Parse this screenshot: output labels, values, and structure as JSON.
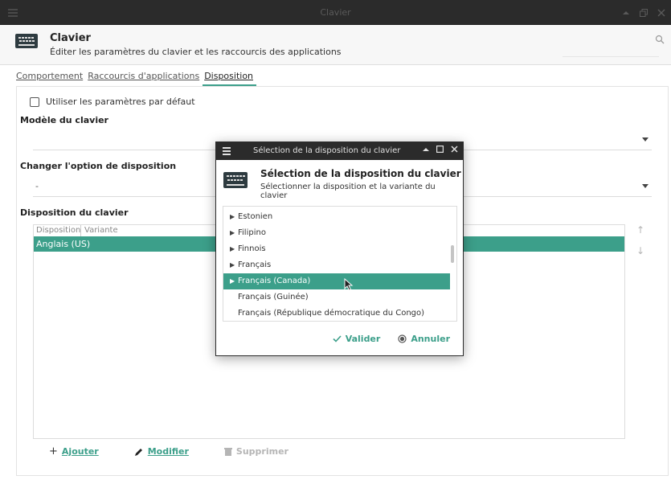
{
  "window": {
    "title": "Clavier",
    "controls": [
      "minimize",
      "restore",
      "close"
    ]
  },
  "header": {
    "title": "Clavier",
    "subtitle": "Éditer les paramètres du clavier et les raccourcis des applications",
    "search_placeholder": ""
  },
  "tabs": [
    {
      "label": "Comportement",
      "active": false
    },
    {
      "label": "Raccourcis d'applications",
      "active": false
    },
    {
      "label": "Disposition",
      "active": true
    }
  ],
  "disposition": {
    "default_checkbox": "Utiliser les paramètres par défaut",
    "default_checked": false,
    "keyboard_model_title": "Modèle du clavier",
    "keyboard_model_value": "",
    "switch_option_title": "Changer l'option de disposition",
    "switch_option_value": "-",
    "layout_title": "Disposition du clavier",
    "table_headers": [
      "Disposition",
      "Variante"
    ],
    "table_rows": [
      {
        "layout": "Anglais (US)",
        "variant": ""
      }
    ],
    "actions": {
      "add": "Ajouter",
      "edit": "Modifier",
      "delete": "Supprimer"
    }
  },
  "dialog": {
    "window_title": "Sélection de la disposition du clavier",
    "title": "Sélection de la disposition du clavier",
    "subtitle": "Sélectionner la disposition et la variante du clavier",
    "items": [
      {
        "label": "Estonien",
        "expandable": true,
        "selected": false
      },
      {
        "label": "Filipino",
        "expandable": true,
        "selected": false
      },
      {
        "label": "Finnois",
        "expandable": true,
        "selected": false
      },
      {
        "label": "Français",
        "expandable": true,
        "selected": false
      },
      {
        "label": "Français (Canada)",
        "expandable": true,
        "selected": true
      },
      {
        "label": "Français (Guinée)",
        "expandable": false,
        "selected": false
      },
      {
        "label": "Français (République démocratique du Congo)",
        "expandable": false,
        "selected": false
      }
    ],
    "ok": "Valider",
    "cancel": "Annuler"
  },
  "colors": {
    "accent": "#3c9f8a",
    "titlebar": "#2b2b2b"
  }
}
